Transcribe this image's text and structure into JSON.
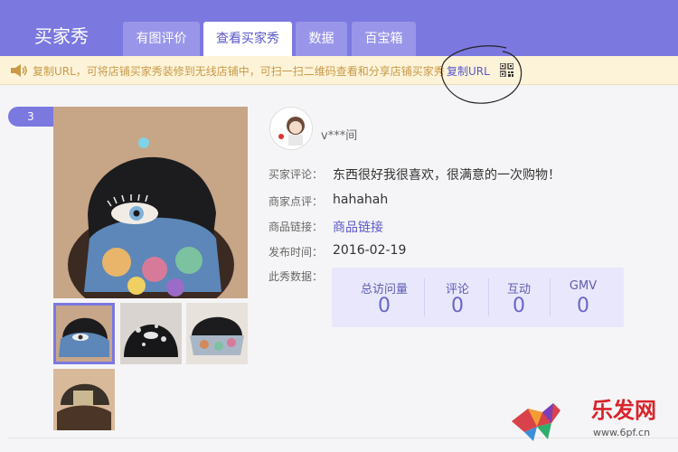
{
  "header": {
    "brand": "买家秀",
    "tabs": [
      {
        "label": "有图评价",
        "active": false
      },
      {
        "label": "查看买家秀",
        "active": true
      },
      {
        "label": "数据",
        "active": false
      },
      {
        "label": "百宝箱",
        "active": false
      }
    ]
  },
  "notice": {
    "text": "复制URL，可将店铺买家秀装修到无线店铺中，可扫一扫二维码查看和分享店铺买家秀",
    "copy_url": "复制URL",
    "icon": "speaker-icon",
    "qr_icon": "qrcode-icon"
  },
  "entry": {
    "rank": "3",
    "username": "v***间",
    "fields": {
      "review_label": "买家评论：",
      "review_value": "东西很好我很喜欢，很满意的一次购物！",
      "reply_label": "商家点评：",
      "reply_value": "hahahah",
      "link_label": "商品链接：",
      "link_value": "商品链接",
      "date_label": "发布时间：",
      "date_value": "2016-02-19",
      "stats_label": "此秀数据："
    },
    "stats": [
      {
        "label": "总访问量",
        "value": "0"
      },
      {
        "label": "评论",
        "value": "0"
      },
      {
        "label": "互动",
        "value": "0"
      },
      {
        "label": "GMV",
        "value": "0"
      }
    ]
  },
  "watermark": {
    "text": "乐发网",
    "url": "www.6pf.cn"
  },
  "colors": {
    "accent": "#7b78e0",
    "notice_bg": "#fdf3d9",
    "notice_text": "#c89a48"
  }
}
